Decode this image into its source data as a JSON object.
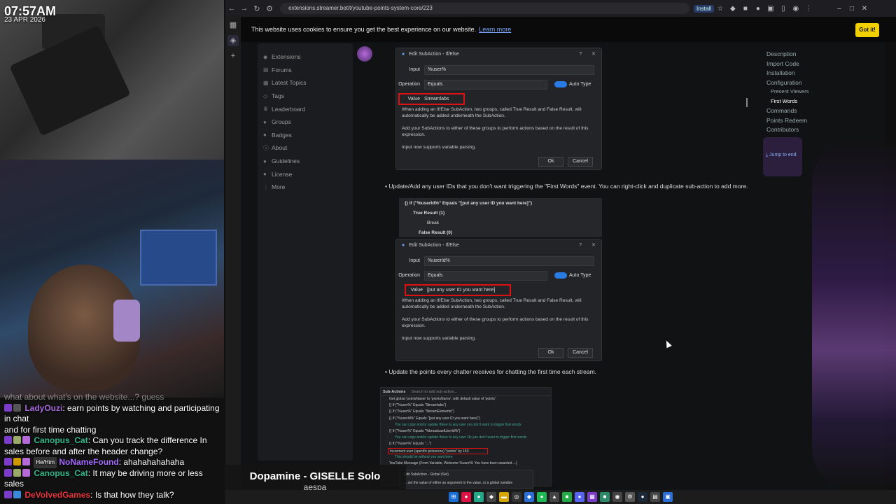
{
  "stream": {
    "clock": "07:57AM",
    "date": "23 APR 2026"
  },
  "chat": [
    {
      "user": "",
      "text": "what about what's on the website...? guess",
      "faded": true
    },
    {
      "user": "LadyOuzi",
      "user_color": "#a66adc",
      "text": ": earn points by watching and participating in chat"
    },
    {
      "user": "",
      "text": "and for first time chatting"
    },
    {
      "user": "Canopus_Cat",
      "user_color": "#2fb88a",
      "text": ": Can you track the difference In sales before and after the header change?"
    },
    {
      "user": "NoNameFound",
      "user_color": "#a56bff",
      "pronoun": "He/Him",
      "text": ": ahahahahahaha"
    },
    {
      "user": "Canopus_Cat",
      "user_color": "#2fb88a",
      "text": ": It may be driving more or less sales"
    },
    {
      "user": "DeVolvedGames",
      "user_color": "#e8343a",
      "text": ": Is that how they talk?"
    }
  ],
  "now_playing": {
    "title": "Dopamine - GISELLE Solo",
    "artist": "aespa"
  },
  "browser": {
    "url": "extensions.streamer.bot/t/youtube-points-system-core/223",
    "install_label": "Install",
    "cookie_text": "This website uses cookies to ensure you get the best experience on our website.",
    "cookie_link": "Learn more",
    "cookie_button": "Got it!"
  },
  "left_nav": [
    "Extensions",
    "Forums",
    "Latest Topics",
    "Tags",
    "Leaderboard",
    "Groups",
    "Badges",
    "About",
    "Guidelines",
    "License",
    "More"
  ],
  "dialog1": {
    "title": "Edit SubAction - If/Else",
    "input_label": "Input",
    "input_value": "%user%",
    "operation_label": "Operation",
    "operation_value": "Equals",
    "auto_type": "Auto Type",
    "value_label": "Value",
    "value_value": "Streamlabs",
    "help1": "When adding an If/Else SubAction, two groups, called True Result and False Result, will automatically be added underneath the SubAction.",
    "help2": "Add your SubActions to either of these groups to perform actions based on the result of this expression.",
    "help3": "Input now supports variable parsing.",
    "ok": "Ok",
    "cancel": "Cancel"
  },
  "bullet1": "Update/Add any user IDs that you don't want triggering the \"First Words\" event. You can right-click and duplicate sub-action to add more.",
  "tree": {
    "if_row": "{} If (\"%userId%\" Equals \"[put any user ID you want here]\")",
    "true_result": "True Result (1)",
    "break": "Break",
    "false_result": "False Result (0)"
  },
  "dialog2": {
    "title": "Edit SubAction - If/Else",
    "input_label": "Input",
    "input_value": "%userId%",
    "operation_label": "Operation",
    "operation_value": "Equals",
    "auto_type": "Auto Type",
    "value_label": "Value",
    "value_value": "[put any user ID you want here]",
    "help1": "When adding an If/Else SubAction, two groups, called True Result and False Result, will automatically be added underneath the SubAction.",
    "help2": "Add your SubActions to either of these groups to perform actions based on the result of this expression.",
    "help3": "Input now supports variable parsing.",
    "ok": "Ok",
    "cancel": "Cancel"
  },
  "bullet2": "Update the points every chatter receives for chatting the first time each stream.",
  "subactions": {
    "tab": "Sub-Actions",
    "search": "Search to add sub-action...",
    "rows": [
      "Get global 'pointsName' to 'pointsName', with default value of 'points'",
      "{} If (\"%user%\" Equals \"Streamlabs\")",
      "{} If (\"%user%\" Equals \"StreamElements\")",
      "{} If (\"%userId%\" Equals \"[put any user ID you want here]\")",
      "You can copy and/or update these to any user you don't want to trigger first words",
      "{} If (\"%user%\" Equals \"%broadcastUserId%\")",
      "You can copy and/or update these to any user Ok you don't want to trigger first words",
      "{} If (\"%user%\" Equals \"...\")",
      "Increment user (specific pickerone) \"points\" by 150",
      "This should be without you want here",
      "YouTube Message (From Variable, Welcome %user%! You have been awarded ...)"
    ]
  },
  "mini_dialog": {
    "title": "Edit SubAction - Global (Set)",
    "text": "... set the value of either an argument to the value, or a global variable"
  },
  "toc": {
    "items": [
      "Description",
      "Import Code",
      "Installation",
      "Configuration"
    ],
    "sub_items": [
      "Present Viewers",
      "First Words"
    ],
    "items2": [
      "Commands",
      "Points Redeem",
      "Contributors"
    ],
    "jump": "Jump to end"
  }
}
